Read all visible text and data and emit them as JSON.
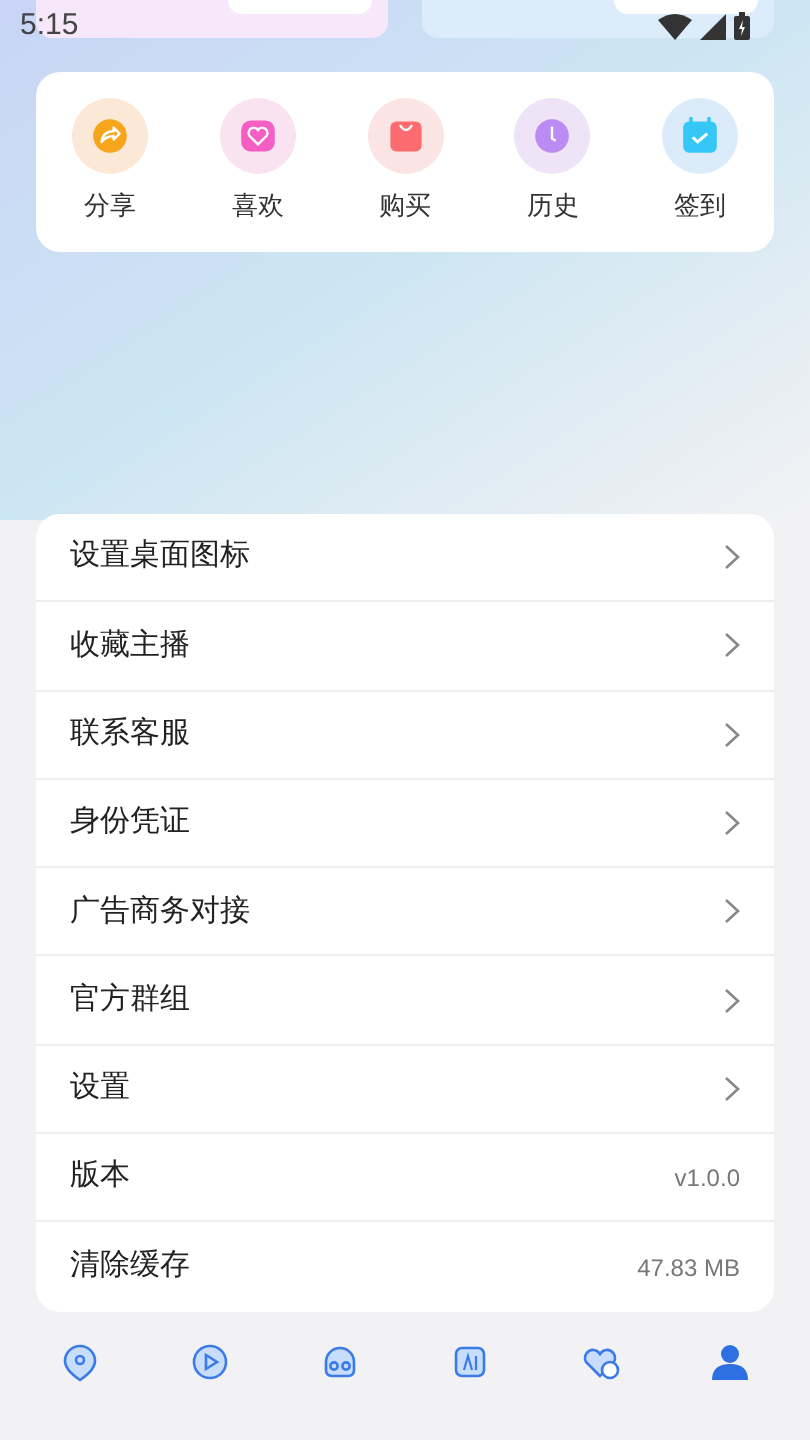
{
  "status_bar": {
    "time": "5:15"
  },
  "quick_actions": [
    {
      "label": "分享",
      "kind": "share"
    },
    {
      "label": "喜欢",
      "kind": "like"
    },
    {
      "label": "购买",
      "kind": "buy"
    },
    {
      "label": "历史",
      "kind": "history"
    },
    {
      "label": "签到",
      "kind": "checkin"
    }
  ],
  "menu": [
    {
      "label": "设置桌面图标",
      "kind": "link"
    },
    {
      "label": "收藏主播",
      "kind": "link"
    },
    {
      "label": "联系客服",
      "kind": "link"
    },
    {
      "label": "身份凭证",
      "kind": "link"
    },
    {
      "label": "广告商务对接",
      "kind": "link"
    },
    {
      "label": "官方群组",
      "kind": "link"
    },
    {
      "label": "设置",
      "kind": "link"
    },
    {
      "label": "版本",
      "kind": "value",
      "value": "v1.0.0"
    },
    {
      "label": "清除缓存",
      "kind": "value",
      "value": "47.83 MB"
    }
  ],
  "bottom_nav": [
    {
      "kind": "pin",
      "selected": false
    },
    {
      "kind": "play",
      "selected": false
    },
    {
      "kind": "skull",
      "selected": false
    },
    {
      "kind": "ai",
      "selected": false
    },
    {
      "kind": "hearts",
      "selected": false
    },
    {
      "kind": "user",
      "selected": true
    }
  ]
}
